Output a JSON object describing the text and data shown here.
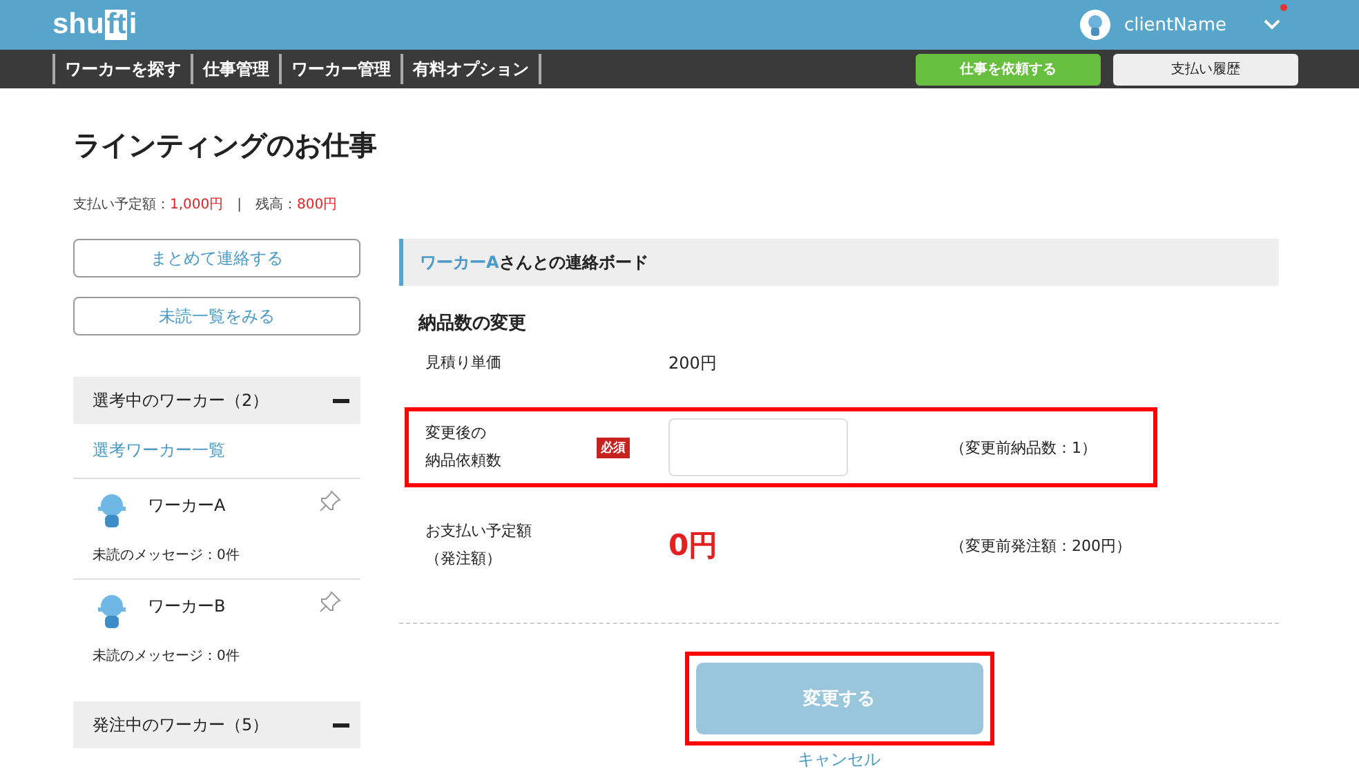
{
  "header": {
    "logo": [
      "shu",
      "ft",
      "i"
    ],
    "user_name": "clientName",
    "has_notification": true
  },
  "nav": {
    "items": [
      "ワーカーを探す",
      "仕事管理",
      "ワーカー管理",
      "有料オプション"
    ],
    "buttons": [
      {
        "label": "仕事を依頼する",
        "kind": "primary"
      },
      {
        "label": "支払い履歴",
        "kind": "secondary"
      }
    ]
  },
  "page": {
    "title": "ラインティングのお仕事",
    "balance": {
      "planned_label": "支払い予定額：",
      "planned_value": "1,000円",
      "separator": "|",
      "remaining_label": "残高：",
      "remaining_value": "800円"
    }
  },
  "sidebar": {
    "buttons": [
      "まとめて連絡する",
      "未読一覧をみる"
    ],
    "sections": [
      {
        "title": "選考中のワーカー（2）",
        "expanded": true,
        "link": "選考ワーカー一覧",
        "workers": [
          {
            "name": "ワーカーA",
            "unread": "未読のメッセージ：0件"
          },
          {
            "name": "ワーカーB",
            "unread": "未読のメッセージ：0件"
          }
        ]
      },
      {
        "title": "発注中のワーカー（5）",
        "expanded": true
      }
    ]
  },
  "board": {
    "title_link": "ワーカーA",
    "title_rest": "さんとの連絡ボード",
    "section_title": "納品数の変更",
    "rows": [
      {
        "kind": "text",
        "label": [
          "見積り単価"
        ],
        "value": "200円",
        "highlighted": false
      },
      {
        "kind": "input",
        "label": [
          "変更後の",
          "納品依頼数"
        ],
        "required": "必須",
        "note": "（変更前納品数：1）",
        "highlighted": true
      },
      {
        "kind": "amount",
        "label": [
          "お支払い予定額",
          "（発注額）"
        ],
        "value": "0円",
        "note": "（変更前発注額：200円）",
        "highlighted": false
      }
    ],
    "submit": {
      "label": "変更する",
      "disabled": true,
      "highlighted": true
    },
    "cancel": "キャンセル"
  }
}
